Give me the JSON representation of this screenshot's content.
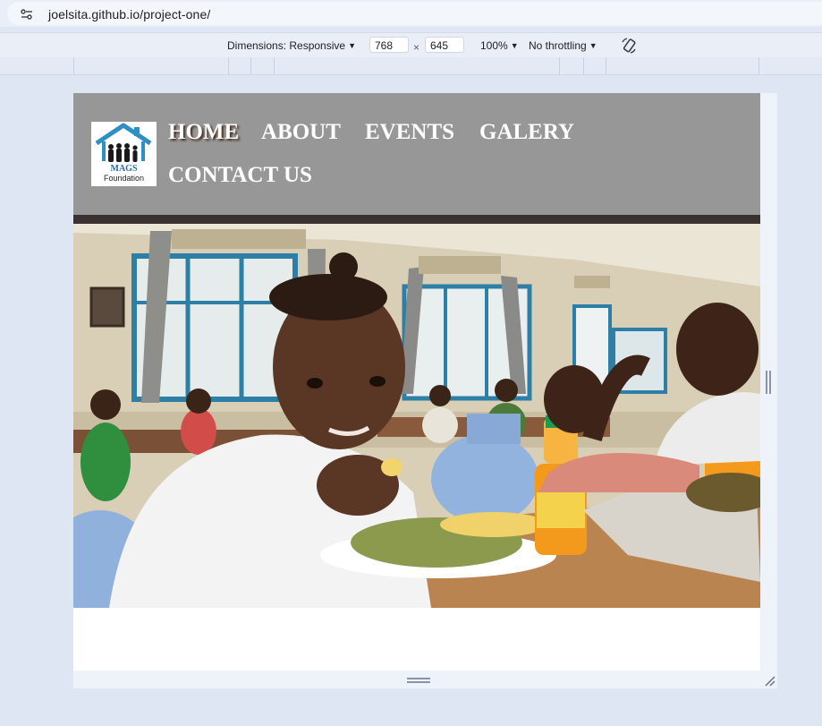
{
  "browser": {
    "url": "joelsita.github.io/project-one/"
  },
  "devtools": {
    "dimensions_label": "Dimensions: Responsive",
    "width": "768",
    "times": "×",
    "height": "645",
    "zoom": "100%",
    "throttling": "No throttling"
  },
  "site": {
    "logo": {
      "name": "MAGS",
      "subtitle": "Foundation"
    },
    "nav": [
      {
        "label": "HOME",
        "active": true
      },
      {
        "label": "ABOUT",
        "active": false
      },
      {
        "label": "EVENTS",
        "active": false
      },
      {
        "label": "GALERY",
        "active": false
      },
      {
        "label": "CONTACT US",
        "active": false
      }
    ],
    "colors": {
      "header_bg": "#979797",
      "nav_text": "#ffffff",
      "logo_blue": "#2d8fc4"
    }
  }
}
